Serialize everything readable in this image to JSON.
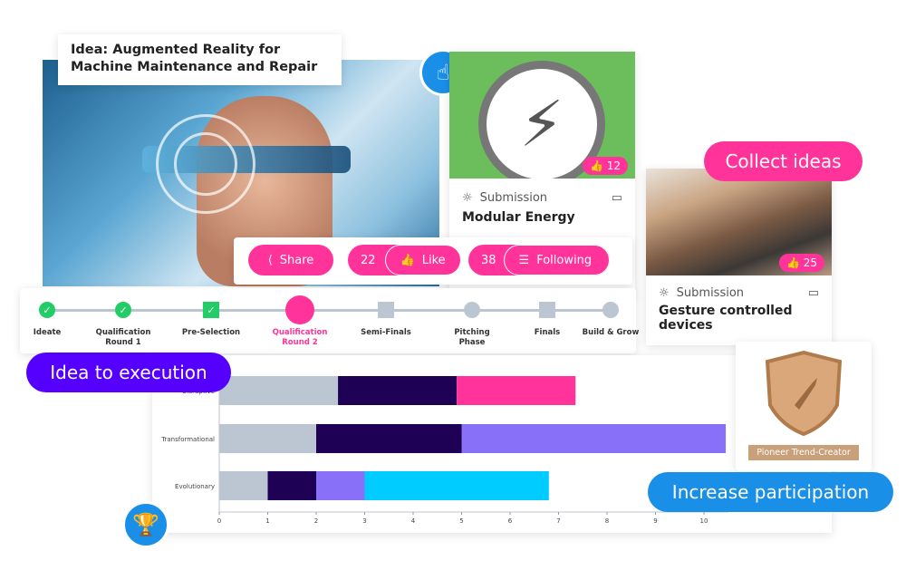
{
  "idea_title": "Idea: Augmented Reality for Machine Maintenance and Repair",
  "actions": {
    "share": "Share",
    "like_count": "22",
    "like": "Like",
    "follow_count": "38",
    "following": "Following"
  },
  "cards": [
    {
      "type": "Submission",
      "title": "Modular Energy",
      "likes": "12"
    },
    {
      "type": "Submission",
      "title": "Gesture controlled devices",
      "likes": "25"
    }
  ],
  "stages": [
    {
      "label": "Ideate",
      "state": "done",
      "shape": "circle"
    },
    {
      "label": "Qualification Round 1",
      "state": "done",
      "shape": "circle"
    },
    {
      "label": "Pre-Selection",
      "state": "done",
      "shape": "square"
    },
    {
      "label": "Qualification Round 2",
      "state": "current",
      "shape": "circle"
    },
    {
      "label": "Semi-Finals",
      "state": "pending",
      "shape": "square"
    },
    {
      "label": "Pitching Phase",
      "state": "pending",
      "shape": "circle"
    },
    {
      "label": "Finals",
      "state": "pending",
      "shape": "square"
    },
    {
      "label": "Build & Grow",
      "state": "pending",
      "shape": "circle"
    }
  ],
  "pills": {
    "collect": "Collect ideas",
    "execution": "Idea to execution",
    "participation": "Increase participation"
  },
  "badge_label": "Pioneer Trend-Creator",
  "colors": {
    "pink": "#ff3399",
    "purple": "#5500ff",
    "blue": "#1a8fe8",
    "green": "#22cc66"
  },
  "chart_data": {
    "type": "bar",
    "orientation": "horizontal",
    "stacked": true,
    "categories": [
      "Disruptive",
      "Transformational",
      "Evolutionary"
    ],
    "segments": [
      [
        {
          "value": 2.45,
          "color": "#bcc6d2"
        },
        {
          "value": 2.45,
          "color": "#1e0055"
        },
        {
          "value": 2.45,
          "color": "#ff3399"
        }
      ],
      [
        {
          "value": 2,
          "color": "#bcc6d2"
        },
        {
          "value": 3,
          "color": "#1e0055"
        },
        {
          "value": 5.45,
          "color": "#8870f8"
        }
      ],
      [
        {
          "value": 1,
          "color": "#bcc6d2"
        },
        {
          "value": 1,
          "color": "#1e0055"
        },
        {
          "value": 1,
          "color": "#8870f8"
        },
        {
          "value": 3.8,
          "color": "#00ccff"
        }
      ]
    ],
    "xlim": [
      0,
      10.5
    ],
    "xticks": [
      0,
      1,
      2,
      3,
      4,
      5,
      6,
      7,
      8,
      9,
      10
    ],
    "grid": false
  }
}
